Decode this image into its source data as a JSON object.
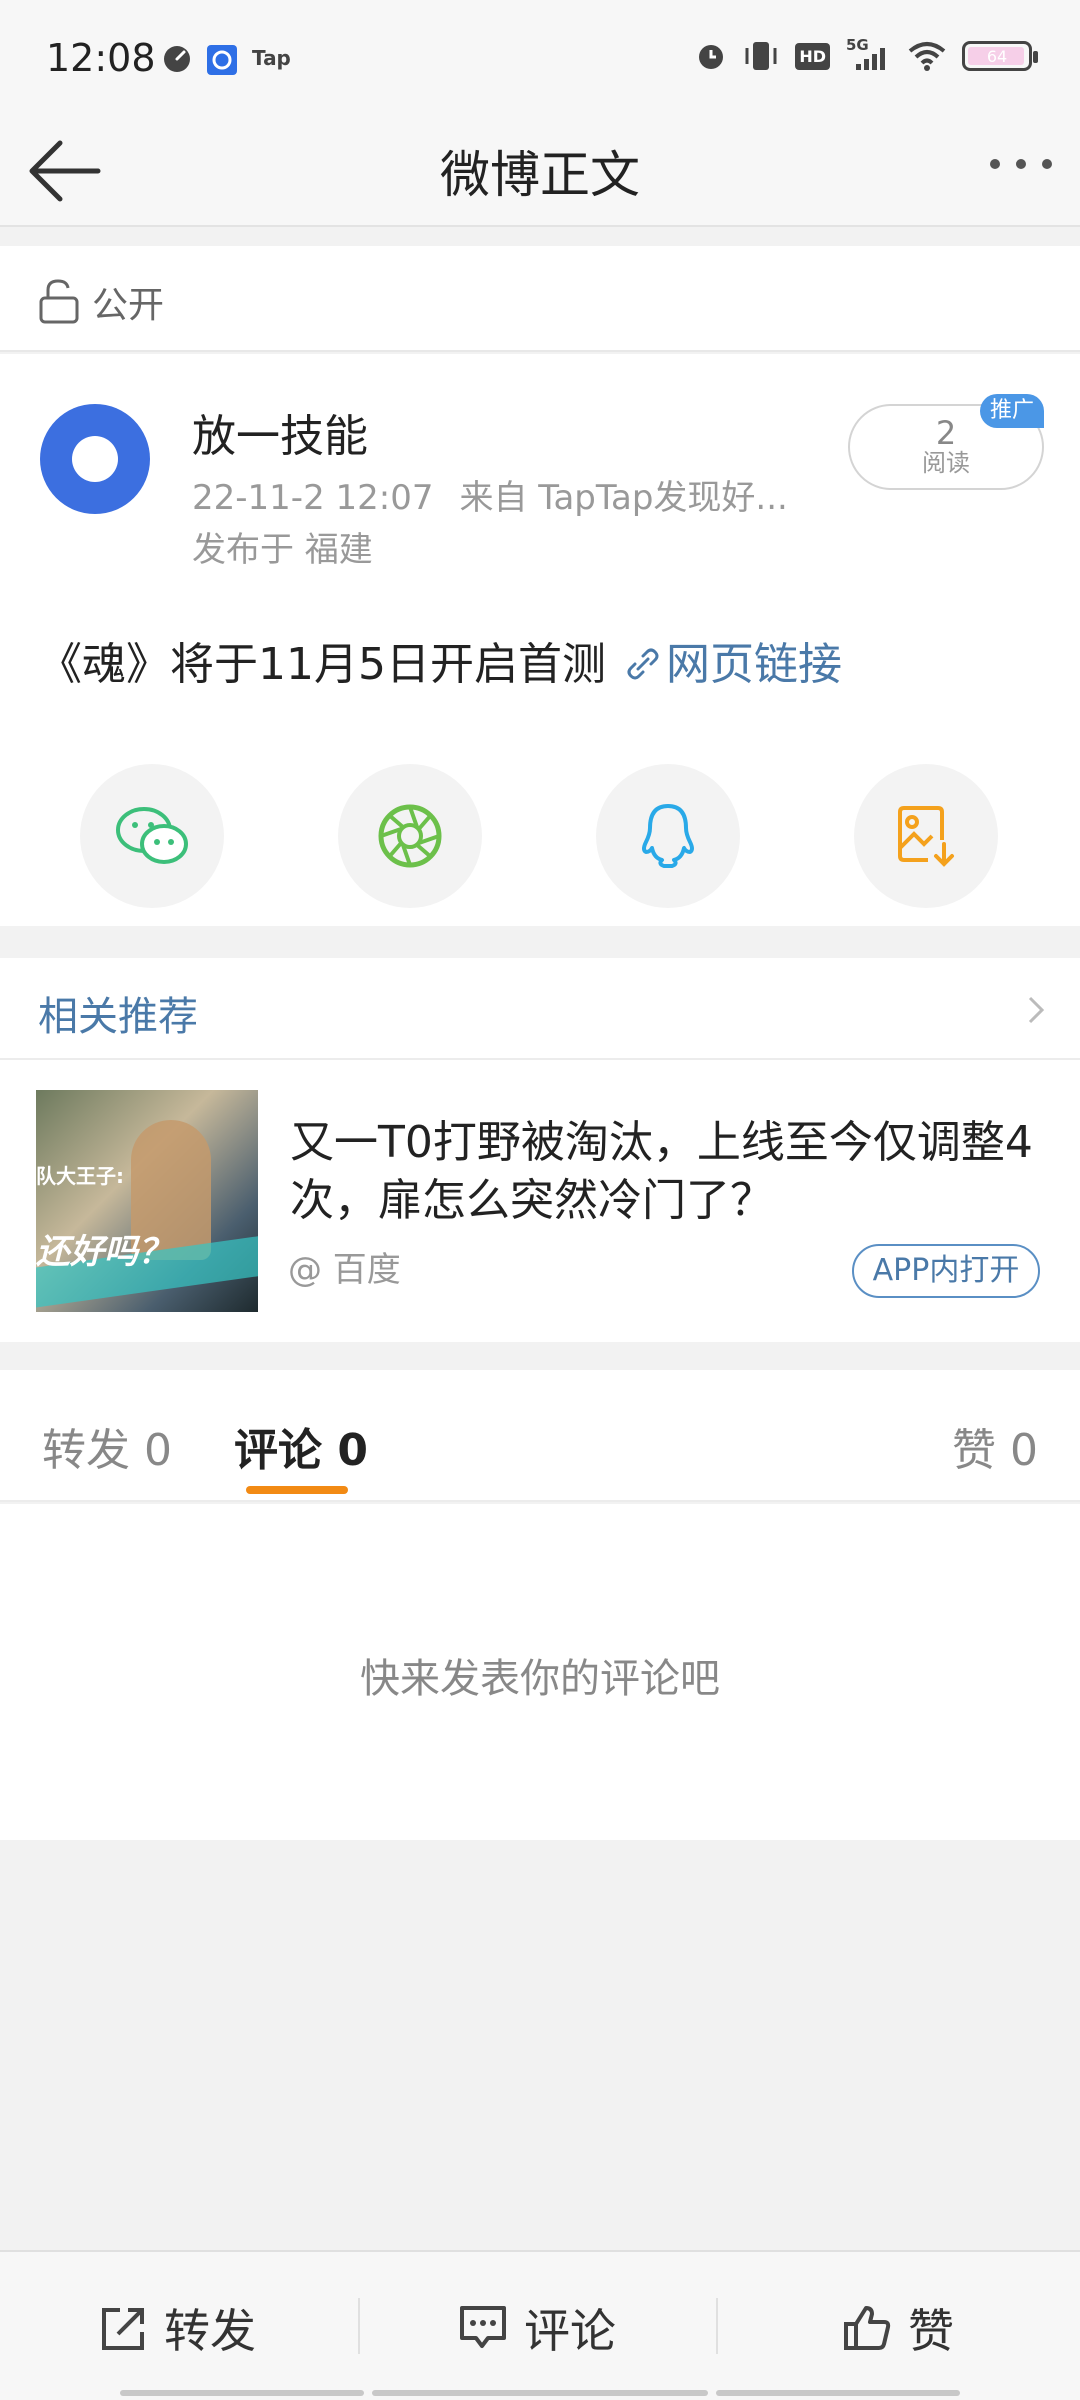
{
  "status_bar": {
    "time": "12:08",
    "app_badge": "Tap",
    "network": "5G",
    "hd": "HD",
    "battery": "64",
    "icons": [
      "speedometer-icon",
      "baidu-app-icon",
      "taptap-icon",
      "alarm-icon",
      "vibrate-icon",
      "hd-icon",
      "signal-icon",
      "wifi-icon",
      "battery-icon"
    ]
  },
  "nav": {
    "title": "微博正文"
  },
  "visibility": {
    "label": "公开"
  },
  "post": {
    "author": "放一技能",
    "time": "22-11-2 12:07",
    "source": "来自 TapTap发现好...",
    "location": "发布于 福建",
    "read_count": "2",
    "read_label": "阅读",
    "promo_tag": "推广",
    "text": "《魂》将于11月5日开启首测",
    "link_text": "网页链接"
  },
  "share": {
    "targets": [
      "wechat-icon",
      "moments-icon",
      "qq-icon",
      "save-image-icon"
    ]
  },
  "related": {
    "title": "相关推荐",
    "item": {
      "headline": "又一T0打野被淘汰，上线至今仅调整4次，扉怎么突然冷门了？",
      "source": "@ 百度",
      "open_label": "APP内打开",
      "thumb_caption_top": "队大王子:",
      "thumb_caption_main": "还好吗？"
    }
  },
  "tabs": {
    "repost": "转发 0",
    "comment": "评论 0",
    "like": "赞 0"
  },
  "comments": {
    "empty_text": "快来发表你的评论吧"
  },
  "toolbar": {
    "repost_label": "转发",
    "comment_label": "评论",
    "like_label": "赞"
  },
  "colors": {
    "accent_link": "#4a79a8",
    "tab_underline": "#f28a14",
    "promo": "#4b97e6",
    "wechat": "#3cbf7a",
    "moments": "#6cc04a",
    "qq": "#29a9e8",
    "save": "#f4a11c"
  }
}
